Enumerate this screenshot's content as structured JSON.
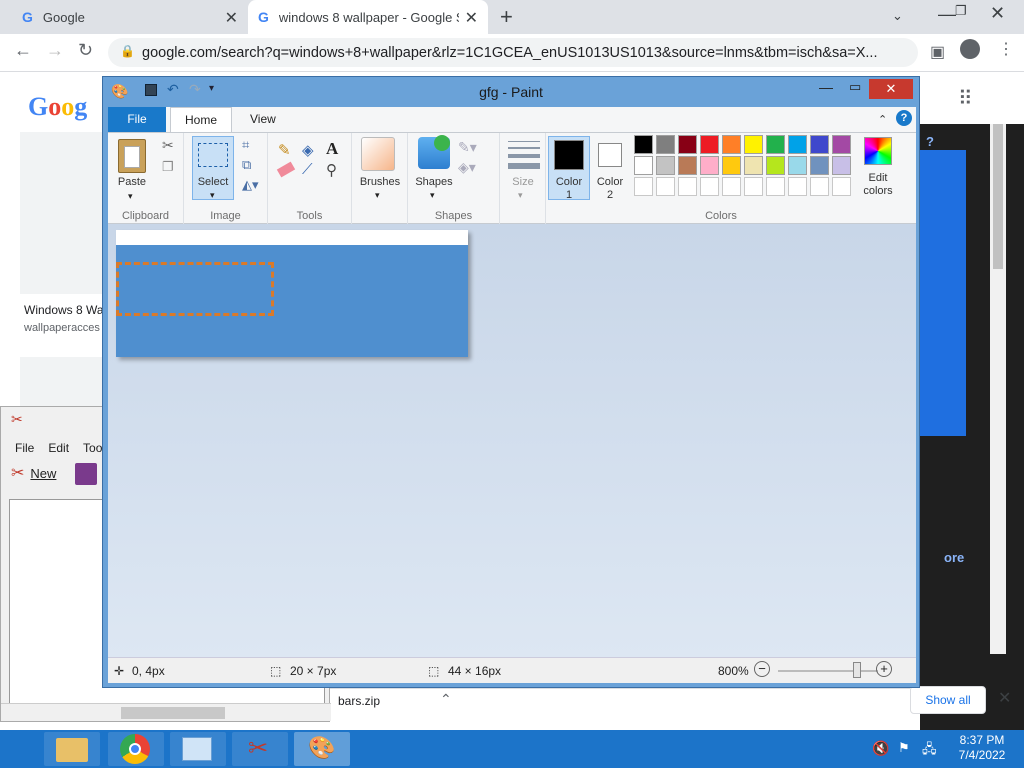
{
  "browser": {
    "tab1_title": "Google",
    "tab2_title": "windows 8 wallpaper - Google S",
    "url": "google.com/search?q=windows+8+wallpaper&rlz=1C1GCEA_enUS1013US1013&source=lnms&tbm=isch&sa=X...",
    "result_title": "Windows 8 Wa",
    "result_source": "wallpaperacces",
    "download_file": "bars.zip",
    "show_all": "Show all",
    "more_fragment": "ore"
  },
  "small_window": {
    "menu": [
      "File",
      "Edit",
      "Too"
    ],
    "new_label": "New"
  },
  "paint": {
    "title": "gfg - Paint",
    "tabs": {
      "file": "File",
      "home": "Home",
      "view": "View"
    },
    "groups": {
      "clipboard": "Clipboard",
      "image": "Image",
      "tools": "Tools",
      "shapes": "Shapes",
      "colors": "Colors"
    },
    "buttons": {
      "paste": "Paste",
      "select": "Select",
      "brushes": "Brushes",
      "shapes": "Shapes",
      "size": "Size",
      "color1": "Color",
      "color1_num": "1",
      "color2": "Color",
      "color2_num": "2",
      "edit_colors_1": "Edit",
      "edit_colors_2": "colors"
    },
    "palette_row1": [
      "#000000",
      "#7f7f7f",
      "#880015",
      "#ed1c24",
      "#ff7f27",
      "#fff200",
      "#22b14c",
      "#00a2e8",
      "#3f48cc",
      "#a349a4"
    ],
    "palette_row2": [
      "#ffffff",
      "#c3c3c3",
      "#b97a57",
      "#ffaec9",
      "#ffc90e",
      "#efe4b0",
      "#b5e61d",
      "#99d9ea",
      "#7092be",
      "#c8bfe7"
    ],
    "status": {
      "cursor_pos": "0, 4px",
      "selection_size": "20 × 7px",
      "image_size": "44 × 16px",
      "zoom": "800%"
    }
  },
  "taskbar": {
    "time": "8:37 PM",
    "date": "7/4/2022"
  }
}
